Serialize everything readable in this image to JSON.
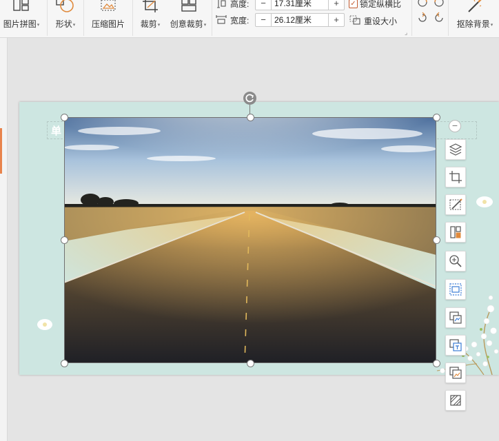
{
  "ribbon": {
    "picture_collage": "图片拼图",
    "shape": "形状",
    "compress": "压缩图片",
    "crop": "裁剪",
    "creative_crop": "创意裁剪",
    "height_label": "高度:",
    "height_value": "17.31厘米",
    "width_label": "宽度:",
    "width_value": "26.12厘米",
    "minus": "−",
    "plus": "+",
    "lock_ratio": "锁定纵横比",
    "lock_ratio_checked": true,
    "reset_size": "重设大小",
    "remove_bg": "抠除背景",
    "accent_color": "#c35a2e"
  },
  "slide": {
    "ghost_text": "单",
    "background": "#cde6e1"
  },
  "floatbar": {
    "collapse_symbol": "−",
    "tools": [
      "layers-icon",
      "crop-icon",
      "edit-picture-icon",
      "split-picture-icon",
      "zoom-icon",
      "fit-icon",
      "replace-picture-icon",
      "picture-to-text-icon",
      "picture-gallery-icon",
      "transparency-icon"
    ]
  }
}
